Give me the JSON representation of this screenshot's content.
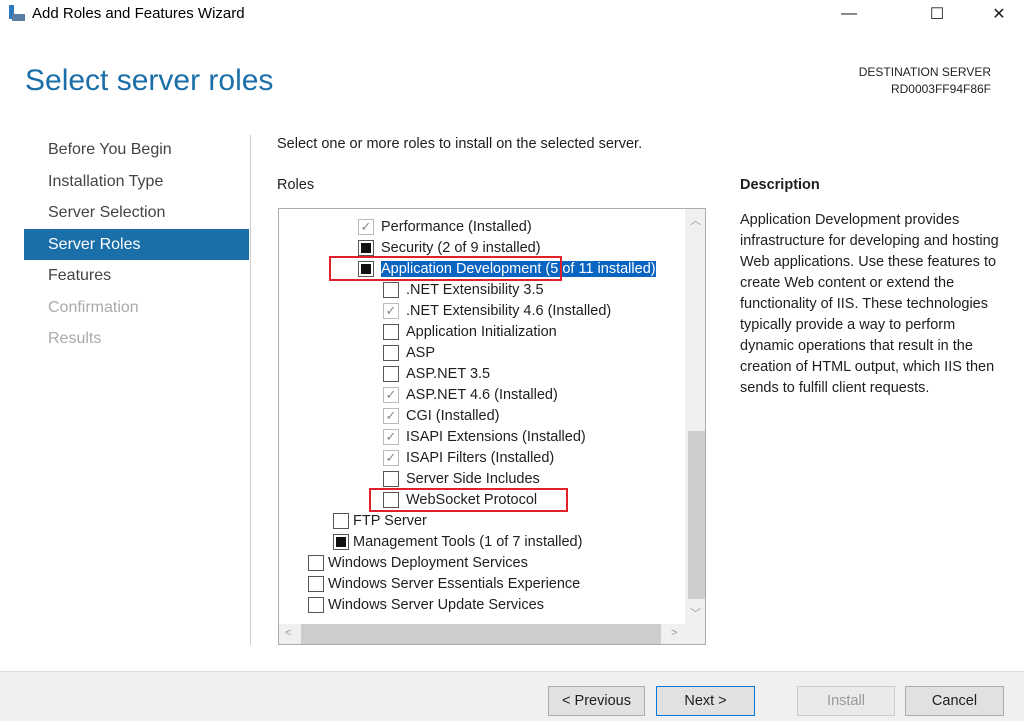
{
  "window": {
    "title": "Add Roles and Features Wizard",
    "minimize": "—",
    "maximize": "☐",
    "close": "✕"
  },
  "header": {
    "page_title": "Select server roles",
    "dest_label": "DESTINATION SERVER",
    "dest_name": "RD0003FF94F86F"
  },
  "nav": [
    {
      "label": "Before You Begin",
      "state": "normal"
    },
    {
      "label": "Installation Type",
      "state": "normal"
    },
    {
      "label": "Server Selection",
      "state": "normal"
    },
    {
      "label": "Server Roles",
      "state": "active"
    },
    {
      "label": "Features",
      "state": "normal"
    },
    {
      "label": "Confirmation",
      "state": "disabled"
    },
    {
      "label": "Results",
      "state": "disabled"
    }
  ],
  "main": {
    "instructions": "Select one or more roles to install on the selected server.",
    "roles_label": "Roles"
  },
  "roles": [
    {
      "label": "Performance (Installed)",
      "level": 1,
      "expander": "collapsed",
      "check": "checked"
    },
    {
      "label": "Security (2 of 9 installed)",
      "level": 1,
      "expander": "collapsed",
      "check": "partial"
    },
    {
      "label": "Application Development",
      "suffix": " (5 of 11 installed)",
      "level": 1,
      "expander": "expanded",
      "check": "partial",
      "selected": true,
      "highlighted": true
    },
    {
      "label": ".NET Extensibility 3.5",
      "level": 2,
      "check": "unchecked"
    },
    {
      "label": ".NET Extensibility 4.6 (Installed)",
      "level": 2,
      "check": "checked"
    },
    {
      "label": "Application Initialization",
      "level": 2,
      "check": "unchecked"
    },
    {
      "label": "ASP",
      "level": 2,
      "check": "unchecked"
    },
    {
      "label": "ASP.NET 3.5",
      "level": 2,
      "check": "unchecked"
    },
    {
      "label": "ASP.NET 4.6 (Installed)",
      "level": 2,
      "check": "checked"
    },
    {
      "label": "CGI (Installed)",
      "level": 2,
      "check": "checked"
    },
    {
      "label": "ISAPI Extensions (Installed)",
      "level": 2,
      "check": "checked"
    },
    {
      "label": "ISAPI Filters (Installed)",
      "level": 2,
      "check": "checked"
    },
    {
      "label": "Server Side Includes",
      "level": 2,
      "check": "unchecked"
    },
    {
      "label": "WebSocket Protocol",
      "level": 2,
      "check": "unchecked",
      "highlighted": true
    },
    {
      "label": "FTP Server",
      "level": 0,
      "expander": "collapsed",
      "check": "unchecked"
    },
    {
      "label": "Management Tools (1 of 7 installed)",
      "level": 0,
      "expander": "collapsed",
      "check": "partial"
    },
    {
      "label": "Windows Deployment Services",
      "level": -1,
      "check": "unchecked"
    },
    {
      "label": "Windows Server Essentials Experience",
      "level": -1,
      "check": "unchecked"
    },
    {
      "label": "Windows Server Update Services",
      "level": -1,
      "check": "unchecked"
    }
  ],
  "description": {
    "label": "Description",
    "text": "Application Development provides infrastructure for developing and hosting Web applications. Use these features to create Web content or extend the functionality of IIS. These technologies typically provide a way to perform dynamic operations that result in the creation of HTML output, which IIS then sends to fulfill client requests."
  },
  "buttons": {
    "previous": "< Previous",
    "next": "Next >",
    "install": "Install",
    "cancel": "Cancel"
  },
  "colors": {
    "accent": "#1b6fa8",
    "selection": "#0a64c2",
    "highlight": "#e0202a"
  }
}
